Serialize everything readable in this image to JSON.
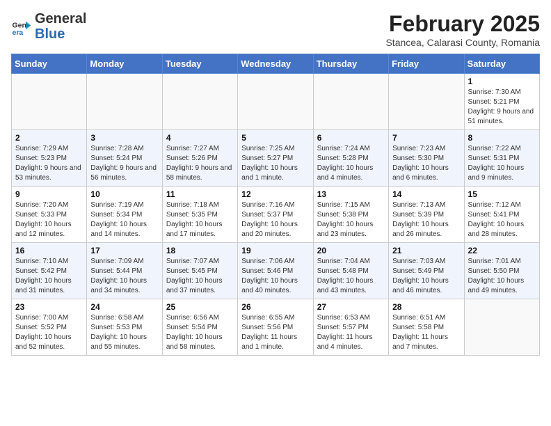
{
  "header": {
    "logo_general": "General",
    "logo_blue": "Blue",
    "month_year": "February 2025",
    "location": "Stancea, Calarasi County, Romania"
  },
  "weekdays": [
    "Sunday",
    "Monday",
    "Tuesday",
    "Wednesday",
    "Thursday",
    "Friday",
    "Saturday"
  ],
  "weeks": [
    [
      {
        "day": "",
        "info": ""
      },
      {
        "day": "",
        "info": ""
      },
      {
        "day": "",
        "info": ""
      },
      {
        "day": "",
        "info": ""
      },
      {
        "day": "",
        "info": ""
      },
      {
        "day": "",
        "info": ""
      },
      {
        "day": "1",
        "info": "Sunrise: 7:30 AM\nSunset: 5:21 PM\nDaylight: 9 hours and 51 minutes."
      }
    ],
    [
      {
        "day": "2",
        "info": "Sunrise: 7:29 AM\nSunset: 5:23 PM\nDaylight: 9 hours and 53 minutes."
      },
      {
        "day": "3",
        "info": "Sunrise: 7:28 AM\nSunset: 5:24 PM\nDaylight: 9 hours and 56 minutes."
      },
      {
        "day": "4",
        "info": "Sunrise: 7:27 AM\nSunset: 5:26 PM\nDaylight: 9 hours and 58 minutes."
      },
      {
        "day": "5",
        "info": "Sunrise: 7:25 AM\nSunset: 5:27 PM\nDaylight: 10 hours and 1 minute."
      },
      {
        "day": "6",
        "info": "Sunrise: 7:24 AM\nSunset: 5:28 PM\nDaylight: 10 hours and 4 minutes."
      },
      {
        "day": "7",
        "info": "Sunrise: 7:23 AM\nSunset: 5:30 PM\nDaylight: 10 hours and 6 minutes."
      },
      {
        "day": "8",
        "info": "Sunrise: 7:22 AM\nSunset: 5:31 PM\nDaylight: 10 hours and 9 minutes."
      }
    ],
    [
      {
        "day": "9",
        "info": "Sunrise: 7:20 AM\nSunset: 5:33 PM\nDaylight: 10 hours and 12 minutes."
      },
      {
        "day": "10",
        "info": "Sunrise: 7:19 AM\nSunset: 5:34 PM\nDaylight: 10 hours and 14 minutes."
      },
      {
        "day": "11",
        "info": "Sunrise: 7:18 AM\nSunset: 5:35 PM\nDaylight: 10 hours and 17 minutes."
      },
      {
        "day": "12",
        "info": "Sunrise: 7:16 AM\nSunset: 5:37 PM\nDaylight: 10 hours and 20 minutes."
      },
      {
        "day": "13",
        "info": "Sunrise: 7:15 AM\nSunset: 5:38 PM\nDaylight: 10 hours and 23 minutes."
      },
      {
        "day": "14",
        "info": "Sunrise: 7:13 AM\nSunset: 5:39 PM\nDaylight: 10 hours and 26 minutes."
      },
      {
        "day": "15",
        "info": "Sunrise: 7:12 AM\nSunset: 5:41 PM\nDaylight: 10 hours and 28 minutes."
      }
    ],
    [
      {
        "day": "16",
        "info": "Sunrise: 7:10 AM\nSunset: 5:42 PM\nDaylight: 10 hours and 31 minutes."
      },
      {
        "day": "17",
        "info": "Sunrise: 7:09 AM\nSunset: 5:44 PM\nDaylight: 10 hours and 34 minutes."
      },
      {
        "day": "18",
        "info": "Sunrise: 7:07 AM\nSunset: 5:45 PM\nDaylight: 10 hours and 37 minutes."
      },
      {
        "day": "19",
        "info": "Sunrise: 7:06 AM\nSunset: 5:46 PM\nDaylight: 10 hours and 40 minutes."
      },
      {
        "day": "20",
        "info": "Sunrise: 7:04 AM\nSunset: 5:48 PM\nDaylight: 10 hours and 43 minutes."
      },
      {
        "day": "21",
        "info": "Sunrise: 7:03 AM\nSunset: 5:49 PM\nDaylight: 10 hours and 46 minutes."
      },
      {
        "day": "22",
        "info": "Sunrise: 7:01 AM\nSunset: 5:50 PM\nDaylight: 10 hours and 49 minutes."
      }
    ],
    [
      {
        "day": "23",
        "info": "Sunrise: 7:00 AM\nSunset: 5:52 PM\nDaylight: 10 hours and 52 minutes."
      },
      {
        "day": "24",
        "info": "Sunrise: 6:58 AM\nSunset: 5:53 PM\nDaylight: 10 hours and 55 minutes."
      },
      {
        "day": "25",
        "info": "Sunrise: 6:56 AM\nSunset: 5:54 PM\nDaylight: 10 hours and 58 minutes."
      },
      {
        "day": "26",
        "info": "Sunrise: 6:55 AM\nSunset: 5:56 PM\nDaylight: 11 hours and 1 minute."
      },
      {
        "day": "27",
        "info": "Sunrise: 6:53 AM\nSunset: 5:57 PM\nDaylight: 11 hours and 4 minutes."
      },
      {
        "day": "28",
        "info": "Sunrise: 6:51 AM\nSunset: 5:58 PM\nDaylight: 11 hours and 7 minutes."
      },
      {
        "day": "",
        "info": ""
      }
    ]
  ]
}
